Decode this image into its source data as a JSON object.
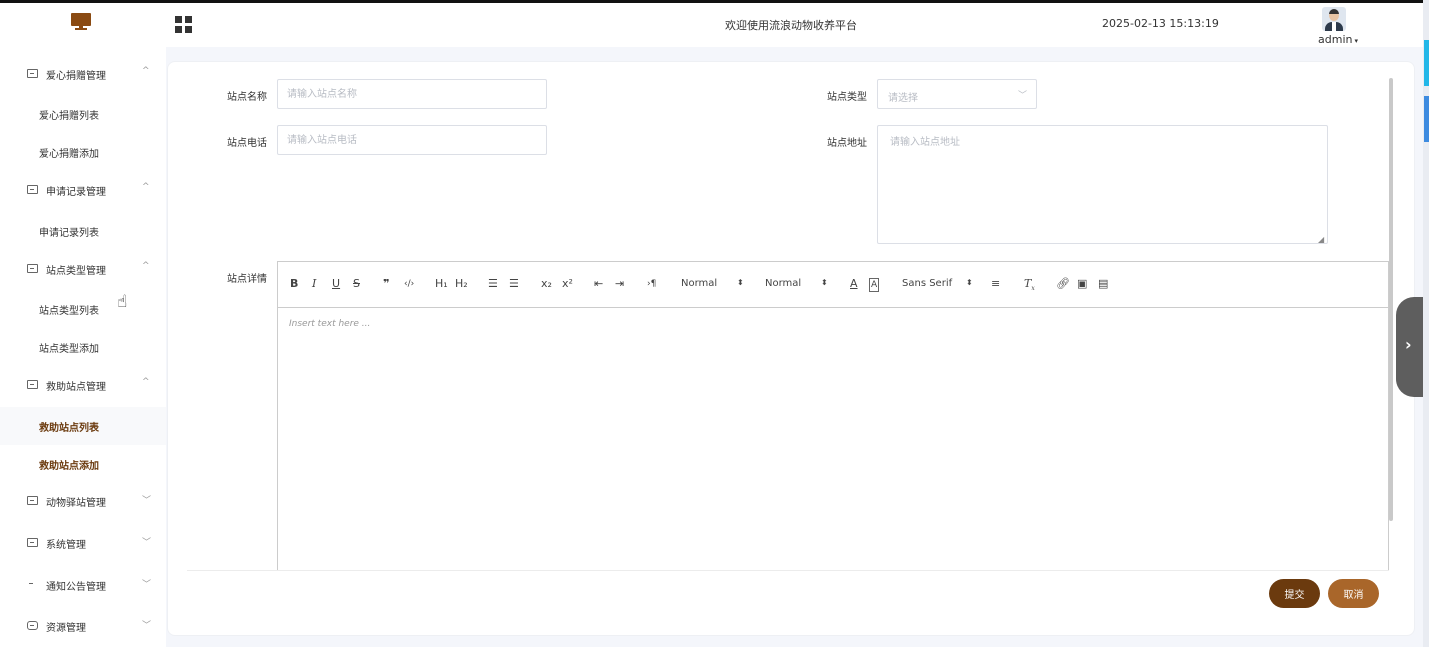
{
  "header": {
    "title": "欢迎使用流浪动物收养平台",
    "datetime": "2025-02-13 15:13:19",
    "user": "admin",
    "caret": "▾"
  },
  "sidebar": {
    "groups": [
      {
        "label": "爱心捐赠管理",
        "expanded": true,
        "items": [
          "爱心捐赠列表",
          "爱心捐赠添加"
        ]
      },
      {
        "label": "申请记录管理",
        "expanded": true,
        "items": [
          "申请记录列表"
        ]
      },
      {
        "label": "站点类型管理",
        "expanded": true,
        "items": [
          "站点类型列表",
          "站点类型添加"
        ]
      },
      {
        "label": "救助站点管理",
        "expanded": true,
        "items": [
          "救助站点列表",
          "救助站点添加"
        ]
      },
      {
        "label": "动物驿站管理",
        "expanded": false,
        "items": []
      },
      {
        "label": "系统管理",
        "expanded": false,
        "items": []
      },
      {
        "label": "通知公告管理",
        "expanded": false,
        "items": []
      },
      {
        "label": "资源管理",
        "expanded": false,
        "items": []
      }
    ],
    "arrow_up": "^",
    "arrow_down": "﹀"
  },
  "form": {
    "name_label": "站点名称",
    "name_placeholder": "请输入站点名称",
    "type_label": "站点类型",
    "type_placeholder": "请选择",
    "phone_label": "站点电话",
    "phone_placeholder": "请输入站点电话",
    "address_label": "站点地址",
    "address_placeholder": "请输入站点地址",
    "detail_label": "站点详情"
  },
  "editor": {
    "font_size": "Normal",
    "header": "Normal",
    "font_family": "Sans Serif",
    "placeholder": "Insert text here ..."
  },
  "buttons": {
    "submit": "提交",
    "cancel": "取消"
  }
}
